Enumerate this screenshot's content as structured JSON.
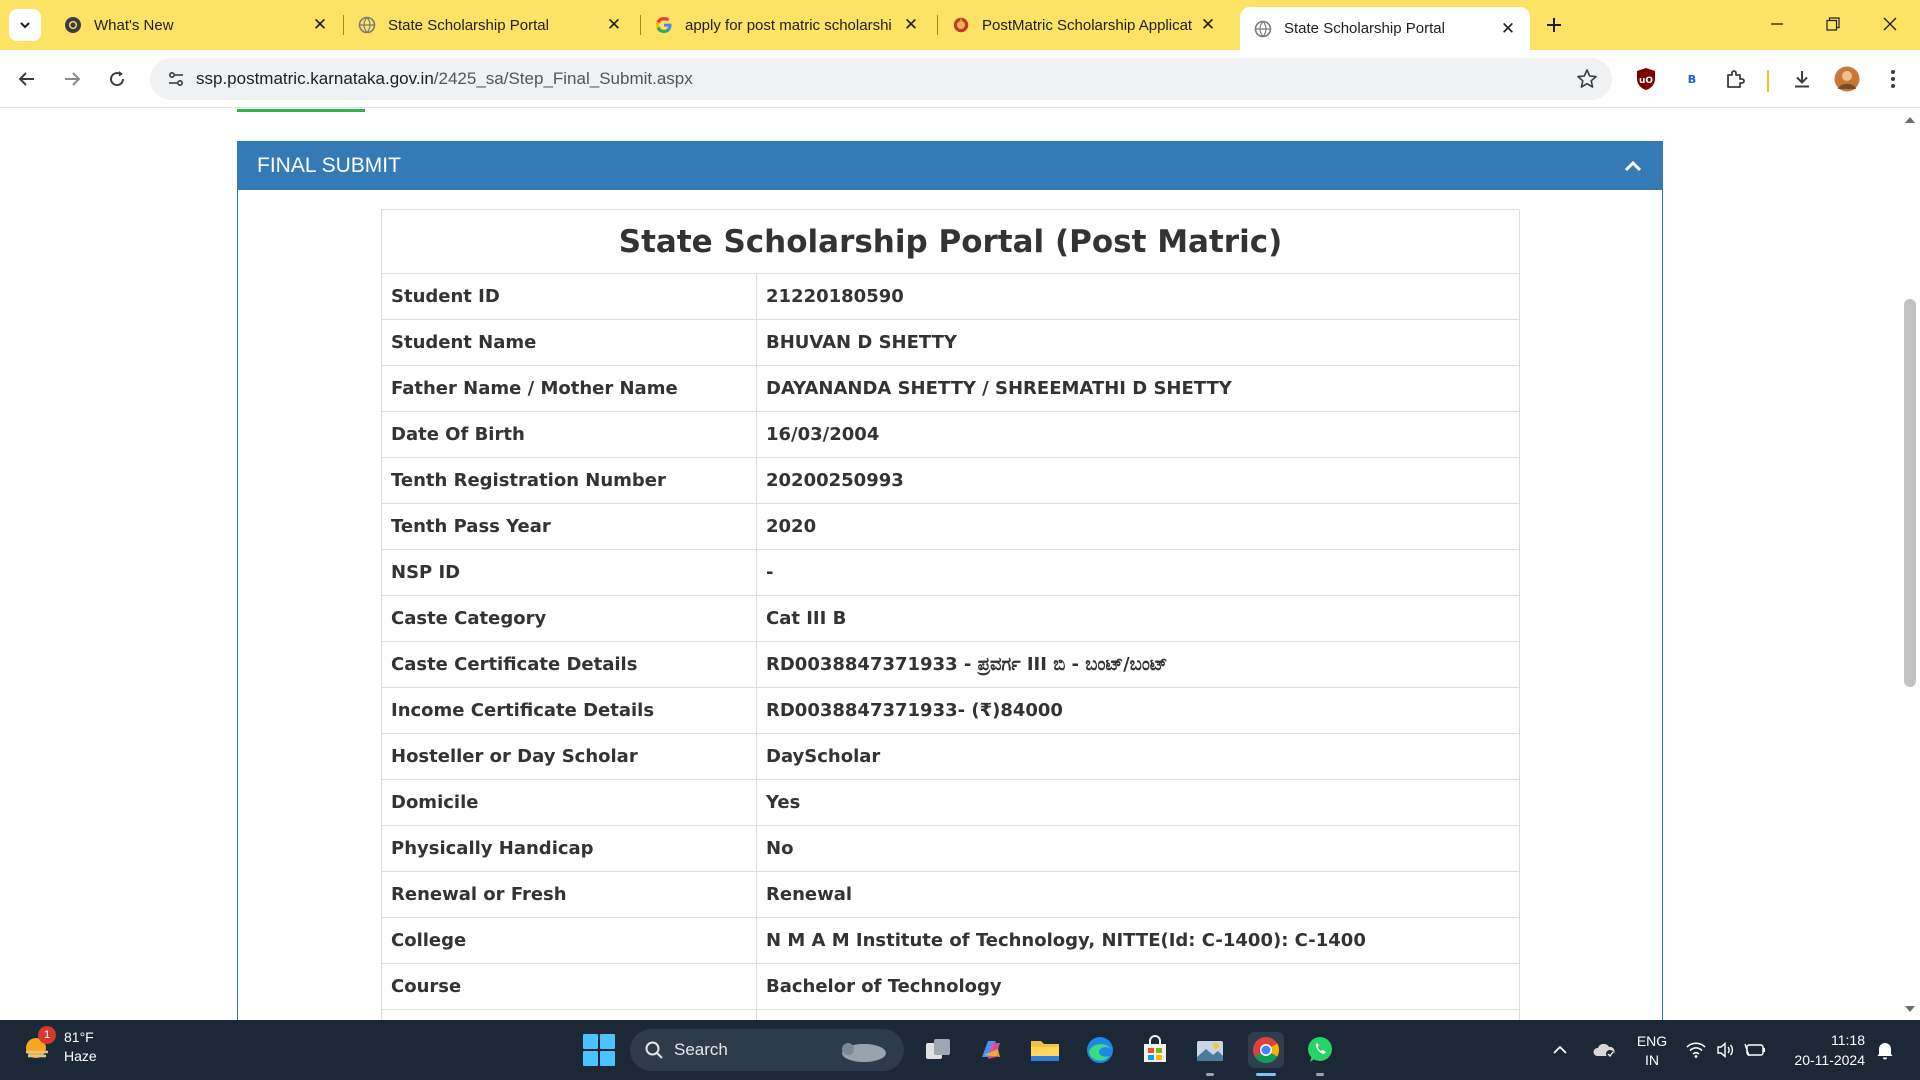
{
  "browser": {
    "tabs": [
      {
        "title": "What's New",
        "icon": "chrome-icon",
        "active": false
      },
      {
        "title": "State Scholarship Portal",
        "icon": "globe-icon",
        "active": false
      },
      {
        "title": "apply for post matric scholarshi",
        "icon": "google-icon",
        "active": false
      },
      {
        "title": "PostMatric Scholarship Applicat",
        "icon": "karnataka-emblem-icon",
        "active": false
      },
      {
        "title": "State Scholarship Portal",
        "icon": "globe-icon",
        "active": true
      }
    ],
    "url_host": "ssp.postmatric.karnataka.gov.in",
    "url_path": "/2425_sa/Step_Final_Submit.aspx",
    "extensions": [
      "ublock-icon",
      "bitwarden-icon",
      "extensions-puzzle-icon",
      "download-icon",
      "profile-avatar"
    ]
  },
  "page": {
    "panel_title": "FINAL SUBMIT",
    "table_title": "State Scholarship Portal (Post Matric)",
    "rows": [
      {
        "label": "Student ID",
        "value": "21220180590"
      },
      {
        "label": "Student Name",
        "value": "BHUVAN D SHETTY"
      },
      {
        "label": "Father Name / Mother Name",
        "value": "DAYANANDA SHETTY / SHREEMATHI D SHETTY"
      },
      {
        "label": "Date Of Birth",
        "value": "16/03/2004"
      },
      {
        "label": "Tenth Registration Number",
        "value": "20200250993"
      },
      {
        "label": "Tenth Pass Year",
        "value": "2020"
      },
      {
        "label": "NSP ID",
        "value": "-"
      },
      {
        "label": "Caste Category",
        "value": "Cat III B"
      },
      {
        "label": "Caste Certificate Details",
        "value": "RD0038847371933 - ಪ್ರವರ್ಗ III ಬಿ - ಬಂಟ್/ಬಂಟ್"
      },
      {
        "label": "Income Certificate Details",
        "value": "RD0038847371933- (₹)84000"
      },
      {
        "label": "Hosteller or Day Scholar",
        "value": "DayScholar"
      },
      {
        "label": "Domicile",
        "value": "Yes"
      },
      {
        "label": "Physically Handicap",
        "value": "No"
      },
      {
        "label": "Renewal or Fresh",
        "value": "Renewal"
      },
      {
        "label": "College",
        "value": "N M A M Institute of Technology, NITTE(Id: C-1400): C-1400"
      },
      {
        "label": "Course",
        "value": "Bachelor of Technology"
      },
      {
        "label": "",
        "value": ""
      }
    ]
  },
  "taskbar": {
    "weather_temp": "81°F",
    "weather_desc": "Haze",
    "weather_badge": "1",
    "search_label": "Search",
    "lang_line1": "ENG",
    "lang_line2": "IN",
    "time": "11:18",
    "date": "20-11-2024"
  }
}
